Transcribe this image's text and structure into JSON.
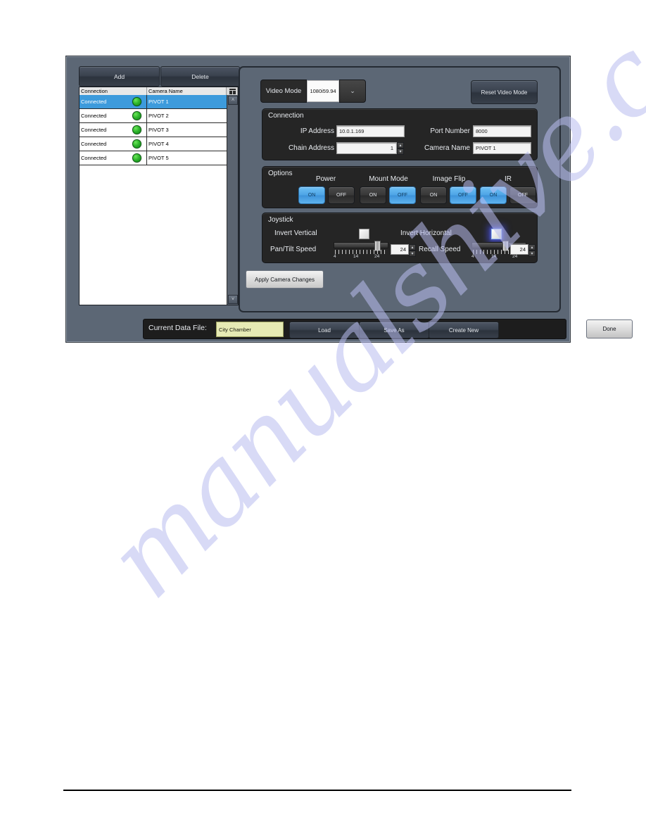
{
  "list_panel": {
    "add_label": "Add",
    "delete_label": "Delete",
    "columns": [
      "Connection",
      "Camera Name"
    ],
    "rows": [
      {
        "connection": "Connected",
        "name": "PIVOT 1",
        "selected": true
      },
      {
        "connection": "Connected",
        "name": "PIVOT 2",
        "selected": false
      },
      {
        "connection": "Connected",
        "name": "PIVOT 3",
        "selected": false
      },
      {
        "connection": "Connected",
        "name": "PIVOT 4",
        "selected": false
      },
      {
        "connection": "Connected",
        "name": "PIVOT 5",
        "selected": false
      }
    ],
    "scroll_up": "˄",
    "scroll_down": "˅"
  },
  "video_mode": {
    "label": "Video Mode",
    "value": "1080i59.94",
    "dropdown_arrow": "⌄",
    "reset_label": "Reset Video Mode"
  },
  "connection": {
    "title": "Connection",
    "ip_label": "IP Address",
    "ip_value": "10.0.1.169",
    "port_label": "Port Number",
    "port_value": "8000",
    "chain_label": "Chain Address",
    "chain_value": "1",
    "camera_name_label": "Camera Name",
    "camera_name_value": "PIVOT 1",
    "spin_up": "▴",
    "spin_down": "▾"
  },
  "options": {
    "title": "Options",
    "on_label": "ON",
    "off_label": "OFF",
    "groups": [
      {
        "name": "Power",
        "state": "ON"
      },
      {
        "name": "Mount Mode",
        "state": "OFF"
      },
      {
        "name": "Image Flip",
        "state": "OFF"
      },
      {
        "name": "IR",
        "state": "ON"
      }
    ]
  },
  "joystick": {
    "title": "Joystick",
    "invert_vertical_label": "Invert Vertical",
    "invert_vertical_checked": false,
    "invert_horizontal_label": "Invert Horizontal",
    "invert_horizontal_checked": false,
    "pan_tilt_label": "Pan/Tilt Speed",
    "pan_tilt_value": "24",
    "recall_label": "Recall Speed",
    "recall_value": "24",
    "tick_min": "4",
    "tick_mid": "14",
    "tick_max": "24",
    "spin_up": "▴",
    "spin_down": "▾"
  },
  "apply": {
    "label": "Apply Camera Changes"
  },
  "bottom_bar": {
    "current_data_file_label": "Current Data File:",
    "current_data_file_value": "City Chamber",
    "load_label": "Load",
    "save_as_label": "Save As",
    "create_new_label": "Create New",
    "done_label": "Done"
  },
  "watermark": {
    "text": "manualshive.com"
  },
  "colors": {
    "accent_blue": "#4da4e6",
    "selection_blue": "#3d9bdc",
    "led_green": "#2db42b",
    "file_field_yellow": "#e6eab4",
    "panel_grey": "#5c6775",
    "block_dark": "#252525"
  }
}
